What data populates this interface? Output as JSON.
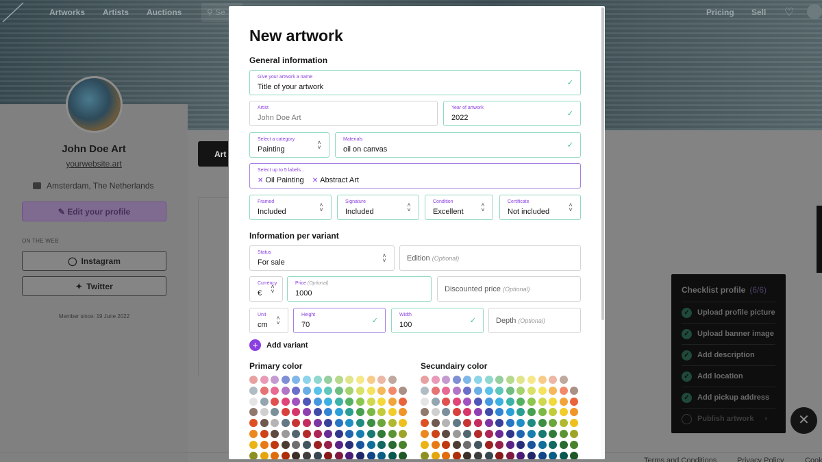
{
  "nav": {
    "items": [
      "Artworks",
      "Artists",
      "Auctions"
    ],
    "search_placeholder": "Se",
    "right_items": [
      "Pricing",
      "Sell"
    ]
  },
  "profile": {
    "name": "John Doe Art",
    "website": "yourwebsite.art",
    "location": "Amsterdam, The Netherlands",
    "edit_label": "Edit your profile",
    "web_label": "ON THE WEB",
    "instagram_label": "Instagram",
    "twitter_label": "Twitter",
    "member_since": "Member since: 19 June 2022",
    "tab_label": "Art"
  },
  "checklist": {
    "title": "Checklist profile",
    "count": "(6/6)",
    "items": [
      {
        "label": "Upload profile picture",
        "done": true
      },
      {
        "label": "Upload banner image",
        "done": true
      },
      {
        "label": "Add description",
        "done": true
      },
      {
        "label": "Add location",
        "done": true
      },
      {
        "label": "Add pickup address",
        "done": true
      },
      {
        "label": "Publish artwork",
        "done": false
      }
    ]
  },
  "footer": {
    "links": [
      "Terms and Conditions",
      "Privacy Policy",
      "Cook"
    ]
  },
  "modal": {
    "title": "New artwork",
    "general_title": "General information",
    "name_field": {
      "label": "Give your artwork a name",
      "value": "Title of your artwork"
    },
    "artist_field": {
      "label": "Artist",
      "value": "John Doe Art"
    },
    "year_field": {
      "label": "Year of artwork",
      "value": "2022"
    },
    "category_field": {
      "label": "Select a category",
      "value": "Painting"
    },
    "materials_field": {
      "label": "Materials",
      "value": "oil on canvas"
    },
    "labels_field": {
      "label": "Select up to 5 labels...",
      "chips": [
        "Oil Painting",
        "Abstract Art"
      ]
    },
    "framed_field": {
      "label": "Framed",
      "value": "Included"
    },
    "signature_field": {
      "label": "Signature",
      "value": "Included"
    },
    "condition_field": {
      "label": "Condition",
      "value": "Excellent"
    },
    "certificate_field": {
      "label": "Certificate",
      "value": "Not included"
    },
    "variant_title": "Information per variant",
    "status_field": {
      "label": "Status",
      "value": "For sale"
    },
    "edition_field": {
      "placeholder": "Edition",
      "optional": "(Optional)"
    },
    "currency_field": {
      "label": "Currency",
      "value": "€"
    },
    "price_field": {
      "label": "Price",
      "optional": "(Optional)",
      "value": "1000"
    },
    "discount_field": {
      "placeholder": "Discounted price",
      "optional": "(Optional)"
    },
    "unit_field": {
      "label": "Unit",
      "value": "cm"
    },
    "height_field": {
      "label": "Height",
      "value": "70"
    },
    "width_field": {
      "label": "Width",
      "value": "100"
    },
    "depth_field": {
      "placeholder": "Depth",
      "optional": "(Optional)"
    },
    "add_variant_label": "Add variant",
    "primary_color_title": "Primary color",
    "secondary_color_title": "Secundairy color",
    "palette_columns": [
      "#e57373",
      "#f06292",
      "#ba68c8",
      "#9575cd",
      "#7986cb",
      "#64b5f6",
      "#4fc3f7",
      "#4dd0e1",
      "#4db6ac",
      "#81c784",
      "#aed581",
      "#dce775",
      "#fff176",
      "#ffd54f",
      "#ffb74d",
      "#ff8a65",
      "#a1887f",
      "#e0e0e0",
      "#90a4ae"
    ],
    "palette_rows": [
      [
        "#e8a0a0",
        "#e99ab7",
        "#c59ad0",
        "#7f8fd6",
        "#7fb8e8",
        "#8dd4ea",
        "#8fd8d0",
        "#95cfa0",
        "#b6d98b",
        "#e0e58a",
        "#f6e88a",
        "#f8cc88",
        "#ecb7a4",
        "#bfa89e",
        "#ffffff",
        "#b0bcc4"
      ],
      [
        "#e57373",
        "#e86a93",
        "#b276c8",
        "#6b6fc9",
        "#6aaee6",
        "#59c2e8",
        "#5fc6bb",
        "#70bd82",
        "#a5d26e",
        "#d9e168",
        "#f5e25e",
        "#f5b85a",
        "#f08a6a",
        "#a99186",
        "#e4e4e4",
        "#93a6b0"
      ],
      [
        "#e0504f",
        "#e04478",
        "#a152be",
        "#4e57b8",
        "#4498e0",
        "#3cb0e0",
        "#3cb2a8",
        "#56b061",
        "#8dc64f",
        "#cfd84e",
        "#f3d83c",
        "#f1a43a",
        "#e8643d",
        "#8f786c",
        "#cfcfcf",
        "#7a8f9a"
      ],
      [
        "#d9403d",
        "#d6366a",
        "#8e3fb0",
        "#404aa8",
        "#3185d4",
        "#2aa0d6",
        "#2a9e93",
        "#47a04f",
        "#7bb844",
        "#c2cc3a",
        "#f1cc2a",
        "#ef952a",
        "#de5024",
        "#6f5a4f",
        "#b4b4b4",
        "#627884"
      ],
      [
        "#c83434",
        "#c42c5e",
        "#7c34a2",
        "#38409a",
        "#2875c4",
        "#1f8fc6",
        "#208c81",
        "#3c8e44",
        "#6aa63c",
        "#b0b830",
        "#eec01e",
        "#ec8820",
        "#cf4318",
        "#5d4b41",
        "#9a9a9a",
        "#526670"
      ],
      [
        "#b22a2a",
        "#ad2554",
        "#6a2c94",
        "#30368a",
        "#2065b0",
        "#177eb0",
        "#187a70",
        "#327c3a",
        "#5a9434",
        "#9ea428",
        "#ebb414",
        "#e87a16",
        "#bf3810",
        "#4c3d34",
        "#6e6e6e",
        "#43565f"
      ],
      [
        "#9c2222",
        "#96204a",
        "#5a2486",
        "#282e7a",
        "#18559c",
        "#0f6e9a",
        "#106860",
        "#286a30",
        "#4a822c",
        "#8c9020",
        "#e4a60c",
        "#e06c0c",
        "#ad2e08",
        "#3c2f28",
        "#3e3e3e",
        "#364750"
      ],
      [
        "#861a1a",
        "#801a40",
        "#4a1c78",
        "#20266a",
        "#104588",
        "#085e86",
        "#085850",
        "#1e5826",
        "#3a7024",
        "#7a7c18",
        "#dc9804",
        "#d85e04",
        "#9c2404",
        "#2c221c",
        "#0c0c0c",
        "#2a3a42"
      ]
    ]
  }
}
